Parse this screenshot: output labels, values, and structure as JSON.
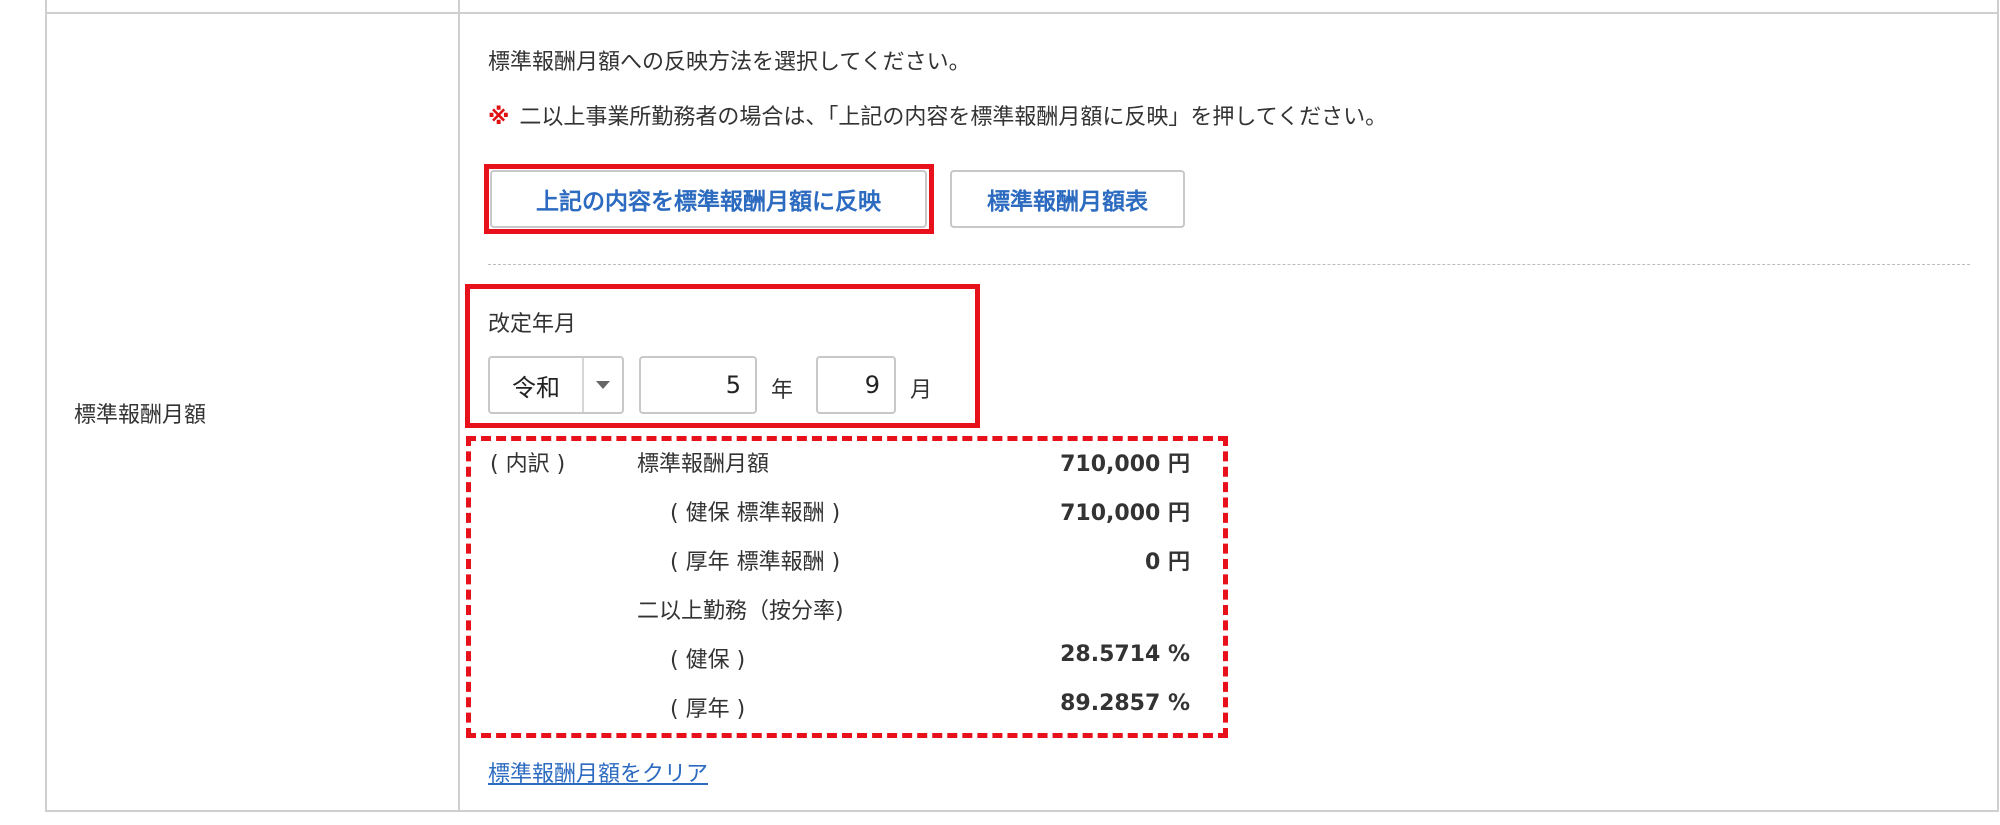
{
  "row": {
    "label": "標準報酬月額"
  },
  "instructions": {
    "select_method": "標準報酬月額への反映方法を選択してください。",
    "note_mark": "※",
    "note_text": "二以上事業所勤務者の場合は、「上記の内容を標準報酬月額に反映」を押してください。"
  },
  "buttons": {
    "reflect_label": "上記の内容を標準報酬月額に反映",
    "table_label": "標準報酬月額表"
  },
  "revision": {
    "label": "改定年月",
    "era_selected": "令和",
    "year_value": "5",
    "year_unit": "年",
    "month_value": "9",
    "month_unit": "月"
  },
  "breakdown": {
    "prefix": "( 内訳 )",
    "rows": [
      {
        "label": "標準報酬月額",
        "value": "710,000 円"
      },
      {
        "label": "( 健保 標準報酬 )",
        "value": "710,000 円"
      },
      {
        "label": "( 厚年 標準報酬 )",
        "value": "0 円"
      },
      {
        "label": "二以上勤務（按分率)",
        "value": ""
      },
      {
        "label": "( 健保 )",
        "value": "28.5714 %"
      },
      {
        "label": "( 厚年 )",
        "value": "89.2857 %"
      }
    ]
  },
  "links": {
    "clear_label": "標準報酬月額をクリア"
  },
  "colors": {
    "accent_link": "#2c6bc0",
    "highlight_red": "#e8101a",
    "border_gray": "#cfcfcf"
  }
}
